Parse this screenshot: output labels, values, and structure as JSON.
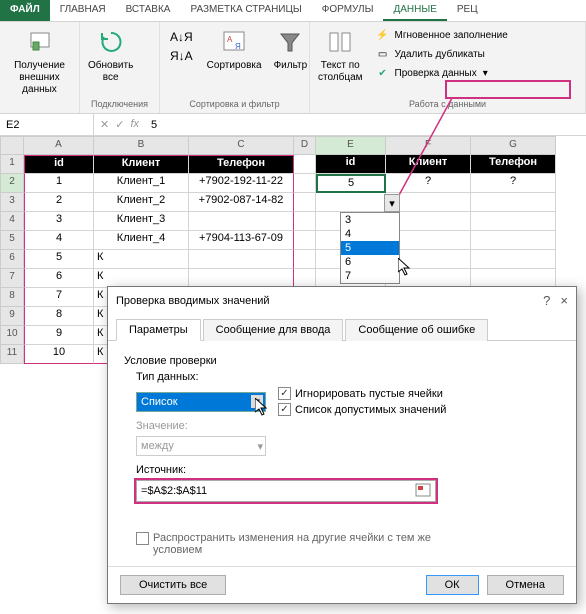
{
  "tabs": {
    "file": "ФАЙЛ",
    "home": "ГЛАВНАЯ",
    "insert": "ВСТАВКА",
    "layout": "РАЗМЕТКА СТРАНИЦЫ",
    "formulas": "ФОРМУЛЫ",
    "data": "ДАННЫЕ",
    "rev": "РЕЦ"
  },
  "ribbon": {
    "get_data": "Получение\nвнешних данных",
    "refresh": "Обновить\nвсе",
    "connections": "Подключения",
    "sort": "Сортировка",
    "filter": "Фильтр",
    "sort_filter_grp": "Сортировка и фильтр",
    "text_cols": "Текст по\nстолбцам",
    "flash": "Мгновенное заполнение",
    "dedup": "Удалить дубликаты",
    "dv": "Проверка данных",
    "data_tools": "Работа с данными"
  },
  "fbar": {
    "name": "E2",
    "fx": "fx",
    "val": "5"
  },
  "cols": [
    "A",
    "B",
    "C",
    "D",
    "E",
    "F",
    "G"
  ],
  "rows": [
    "1",
    "2",
    "3",
    "4",
    "5",
    "6",
    "7",
    "8",
    "9",
    "10",
    "11"
  ],
  "table1_hdr": {
    "id": "id",
    "client": "Клиент",
    "phone": "Телефон"
  },
  "table1": [
    {
      "id": "1",
      "client": "Клиент_1",
      "phone": "+7902-192-11-22"
    },
    {
      "id": "2",
      "client": "Клиент_2",
      "phone": "+7902-087-14-82"
    },
    {
      "id": "3",
      "client": "Клиент_3",
      "phone": ""
    },
    {
      "id": "4",
      "client": "Клиент_4",
      "phone": "+7904-113-67-09"
    },
    {
      "id": "5",
      "client": "К",
      "phone": ""
    },
    {
      "id": "6",
      "client": "К",
      "phone": ""
    },
    {
      "id": "7",
      "client": "К",
      "phone": ""
    },
    {
      "id": "8",
      "client": "К",
      "phone": ""
    },
    {
      "id": "9",
      "client": "К",
      "phone": ""
    },
    {
      "id": "10",
      "client": "К",
      "phone": ""
    }
  ],
  "table2_hdr": {
    "id": "id",
    "client": "Клиент",
    "phone": "Телефон"
  },
  "table2": {
    "id": "5",
    "client": "?",
    "phone": "?"
  },
  "dropdown": {
    "opts": [
      "3",
      "4",
      "5",
      "6",
      "7"
    ],
    "sel": "5"
  },
  "dialog": {
    "title": "Проверка вводимых значений",
    "help": "?",
    "close": "×",
    "tab1": "Параметры",
    "tab2": "Сообщение для ввода",
    "tab3": "Сообщение об ошибке",
    "cond": "Условие проверки",
    "type_lbl": "Тип данных:",
    "type_val": "Список",
    "ignore": "Игнорировать пустые ячейки",
    "list": "Список допустимых значений",
    "val_lbl": "Значение:",
    "val_val": "между",
    "src_lbl": "Источник:",
    "src_val": "=$A$2:$A$11",
    "spread": "Распространить изменения на другие ячейки с тем же условием",
    "clear": "Очистить все",
    "ok": "ОК",
    "cancel": "Отмена"
  }
}
